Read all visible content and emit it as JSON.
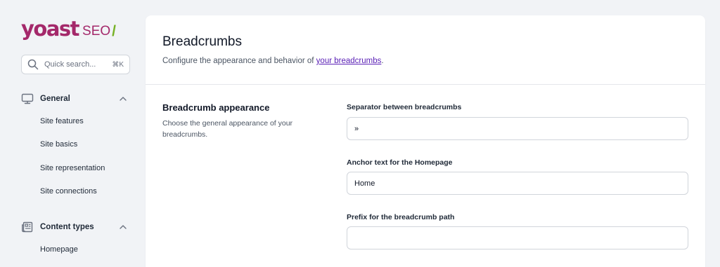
{
  "logo": {
    "wordmark": "yoast",
    "product": "SEO",
    "slash": "/"
  },
  "search": {
    "placeholder": "Quick search...",
    "shortcut": "⌘K"
  },
  "sidebar": {
    "groups": [
      {
        "title": "General",
        "icon": "desktop-icon",
        "items": [
          "Site features",
          "Site basics",
          "Site representation",
          "Site connections"
        ]
      },
      {
        "title": "Content types",
        "icon": "newspaper-icon",
        "items": [
          "Homepage"
        ]
      }
    ]
  },
  "page": {
    "title": "Breadcrumbs",
    "description_prefix": "Configure the appearance and behavior of ",
    "description_link": "your breadcrumbs",
    "description_suffix": "."
  },
  "section": {
    "title": "Breadcrumb appearance",
    "description": "Choose the general appearance of your breadcrumbs."
  },
  "fields": [
    {
      "label": "Separator between breadcrumbs",
      "value": "»"
    },
    {
      "label": "Anchor text for the Homepage",
      "value": "Home"
    },
    {
      "label": "Prefix for the breadcrumb path",
      "value": ""
    }
  ],
  "colors": {
    "brand": "#a4286a",
    "accent": "#77b227",
    "link": "#5b21b6",
    "background": "#f1f3f6"
  }
}
